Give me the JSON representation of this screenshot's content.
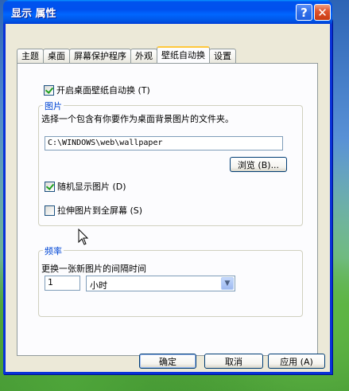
{
  "window": {
    "title": "显示 属性",
    "help_label": "?",
    "close_label": "✕"
  },
  "tabs": [
    {
      "label": "主题"
    },
    {
      "label": "桌面"
    },
    {
      "label": "屏幕保护程序"
    },
    {
      "label": "外观"
    },
    {
      "label": "壁纸自动换"
    },
    {
      "label": "设置"
    }
  ],
  "panel": {
    "enable_label": "开启桌面壁纸自动换 (T)",
    "enable_checked": true,
    "pictures_group": {
      "label": "图片",
      "description": "选择一个包含有你要作为桌面背景图片的文件夹。",
      "folder_path": "C:\\WINDOWS\\web\\wallpaper",
      "browse_label": "浏览 (B)...",
      "random_label": "随机显示图片 (D)",
      "random_checked": true,
      "stretch_label": "拉伸图片到全屏幕 (S)",
      "stretch_checked": false
    },
    "frequency_group": {
      "label": "频率",
      "interval_label": "更换一张新图片的间隔时间",
      "interval_value": "1",
      "unit_value": "小时"
    }
  },
  "buttons": {
    "ok": "确定",
    "cancel": "取消",
    "apply": "应用 (A)"
  }
}
